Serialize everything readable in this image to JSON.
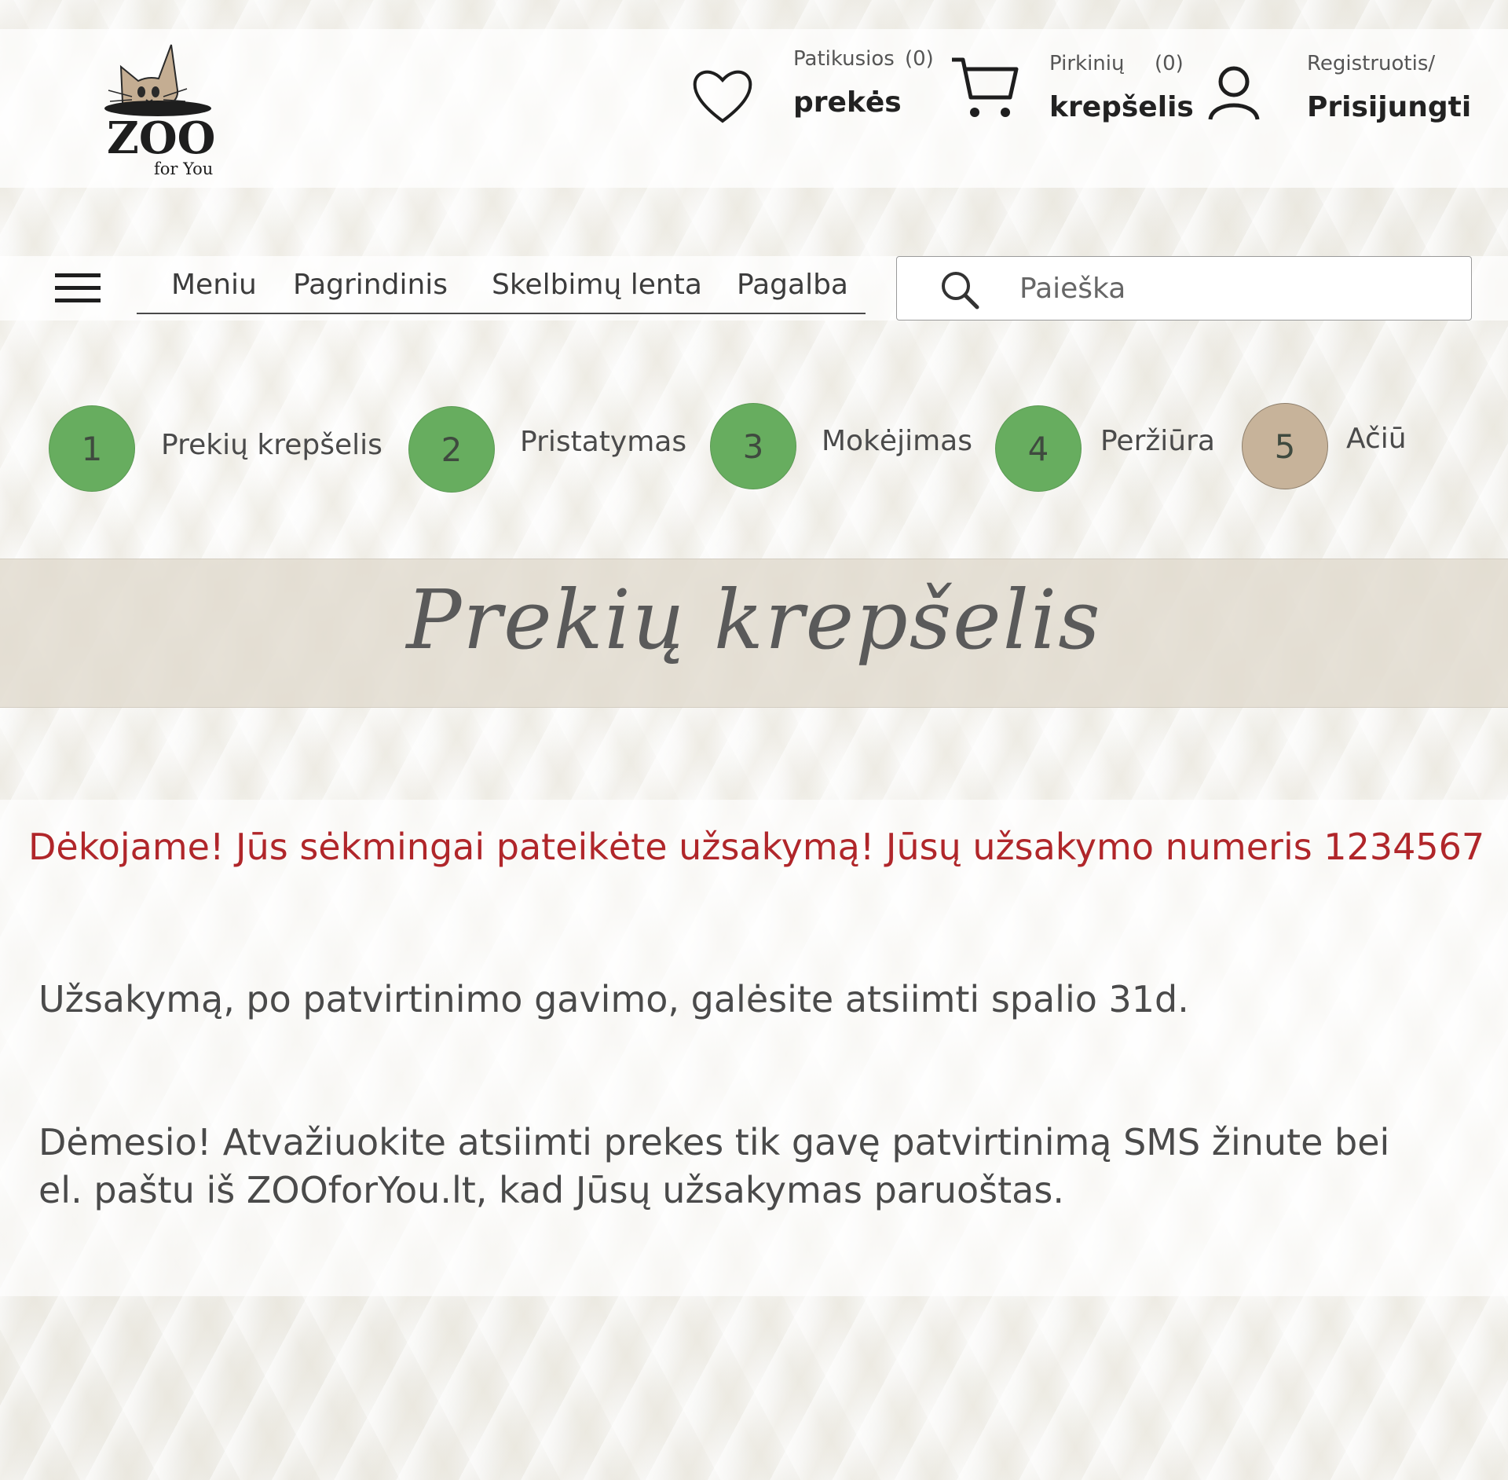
{
  "header": {
    "logo": {
      "word": "ZOO",
      "sub": "for You"
    },
    "favorites": {
      "small": "Patikusios",
      "count": "(0)",
      "big": "prekės"
    },
    "cart": {
      "small": "Pirkinių",
      "count": "(0)",
      "big": "krepšelis"
    },
    "account": {
      "small": "Registruotis/",
      "big": "Prisijungti"
    }
  },
  "nav": {
    "items": [
      {
        "label": "Meniu"
      },
      {
        "label": "Pagrindinis"
      },
      {
        "label": "Skelbimų lenta"
      },
      {
        "label": "Pagalba"
      }
    ]
  },
  "search": {
    "placeholder": "Paieška"
  },
  "steps": [
    {
      "number": "1",
      "label": "Prekių krepšelis",
      "color": "#67ad5f"
    },
    {
      "number": "2",
      "label": "Pristatymas",
      "color": "#67ad5f"
    },
    {
      "number": "3",
      "label": "Mokėjimas",
      "color": "#67ad5f"
    },
    {
      "number": "4",
      "label": "Peržiūra",
      "color": "#67ad5f"
    },
    {
      "number": "5",
      "label": "Ačiū",
      "color": "#c7b39a"
    }
  ],
  "page_title": "Prekių krepšelis",
  "content": {
    "success": "Dėkojame! Jūs sėkmingai pateikėte užsakymą! Jūsų užsakymo numeris 1234567",
    "pickup": "Užsakymą, po patvirtinimo gavimo, galėsite atsiimti spalio 31d.",
    "notice_line1": "Dėmesio! Atvažiuokite atsiimti prekes tik gavę patvirtinimą SMS žinute bei",
    "notice_line2": "el. paštu iš ZOOforYou.lt, kad Jūsų užsakymas paruoštas."
  },
  "colors": {
    "step_done": "#67ad5f",
    "step_current": "#c7b39a",
    "success_text": "#b0262a",
    "logo_cat": "#c4ad92"
  }
}
